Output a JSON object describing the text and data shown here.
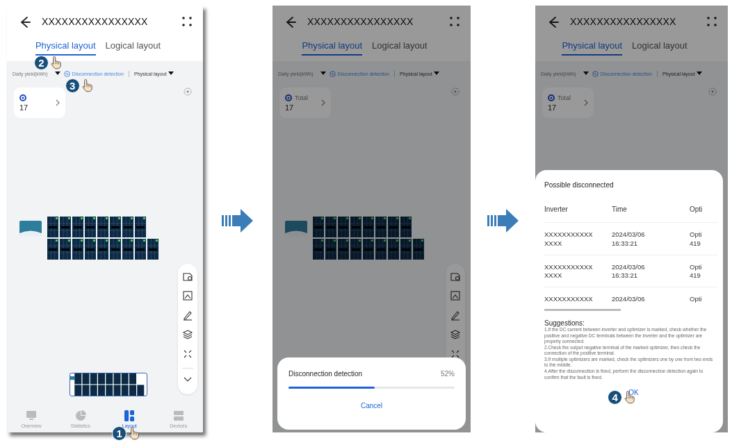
{
  "screens": [
    {
      "header": {
        "title": "XXXXXXXXXXXXXXXX"
      },
      "tabs": [
        {
          "label": "Physical layout",
          "selected": true,
          "step": "2"
        },
        {
          "label": "Logical layout",
          "selected": false
        }
      ],
      "filters": {
        "metric": "Daily yield(kWh)",
        "detect": "Disconnection detection",
        "detect_step": "3",
        "view": "Physical layout"
      },
      "summary": {
        "count": "17"
      },
      "canvas": {
        "tools": true,
        "minimap": true
      },
      "nav": [
        {
          "label": "Overview",
          "selected": false
        },
        {
          "label": "Statistics",
          "selected": false
        },
        {
          "label": "Layout",
          "selected": true,
          "step": "1"
        },
        {
          "label": "Devices",
          "selected": false
        }
      ],
      "dimmed": false
    },
    {
      "header": {
        "title": "XXXXXXXXXXXXXXXX"
      },
      "tabs": [
        {
          "label": "Physical layout",
          "selected": true
        },
        {
          "label": "Logical layout",
          "selected": false
        }
      ],
      "filters": {
        "metric": "Daily yield(kWh)",
        "detect": "Disconnection detection",
        "view": "Physical layout"
      },
      "summary": {
        "label": "Total",
        "count": "17"
      },
      "canvas": {
        "tools": true
      },
      "dimmed": true,
      "dialog": {
        "kind": "progress",
        "title": "Disconnection detection",
        "reading": "52%",
        "level": 0.52,
        "button": "Cancel"
      }
    },
    {
      "header": {
        "title": "XXXXXXXXXXXXXXXX"
      },
      "tabs": [
        {
          "label": "Physical layout",
          "selected": true
        },
        {
          "label": "Logical layout",
          "selected": false
        }
      ],
      "filters": {
        "metric": "Daily yield(kWh)",
        "detect": "Disconnection detection",
        "view": "Physical layout"
      },
      "summary": {
        "label": "Total",
        "count": "17"
      },
      "dimmed": true,
      "dialog": {
        "kind": "results",
        "title": "Possible disconnected",
        "columns": [
          "Inverter",
          "Time",
          "Opti"
        ],
        "rows": [
          [
            "XXXXXXXXXXX\nXXXX",
            "2024/03/06\n16:33:21",
            "Opti\n419"
          ],
          [
            "XXXXXXXXXXX\nXXXX",
            "2024/03/06\n16:33:21",
            "Opti\n419"
          ],
          [
            "XXXXXXXXXXX",
            "2024/03/06",
            "Opti"
          ]
        ],
        "suggestions_title": "Suggestions:",
        "suggestions": [
          "1.If the DC current between inverter and optimizer is marked, check whether the positive and negative DC terminals between the inverter and the optimizer are properly connected.",
          "2.Check the output negative terminal of the marked optimizer, then check the connection of the positive terminal.",
          "3.If multiple optimizers are marked, check the optimizers one by one from two ends to the middle.",
          "4.After the disconnection is fixed, perform the disconnection detection again to confirm that the fault is fixed."
        ],
        "button": "OK",
        "button_step": "4"
      }
    }
  ]
}
